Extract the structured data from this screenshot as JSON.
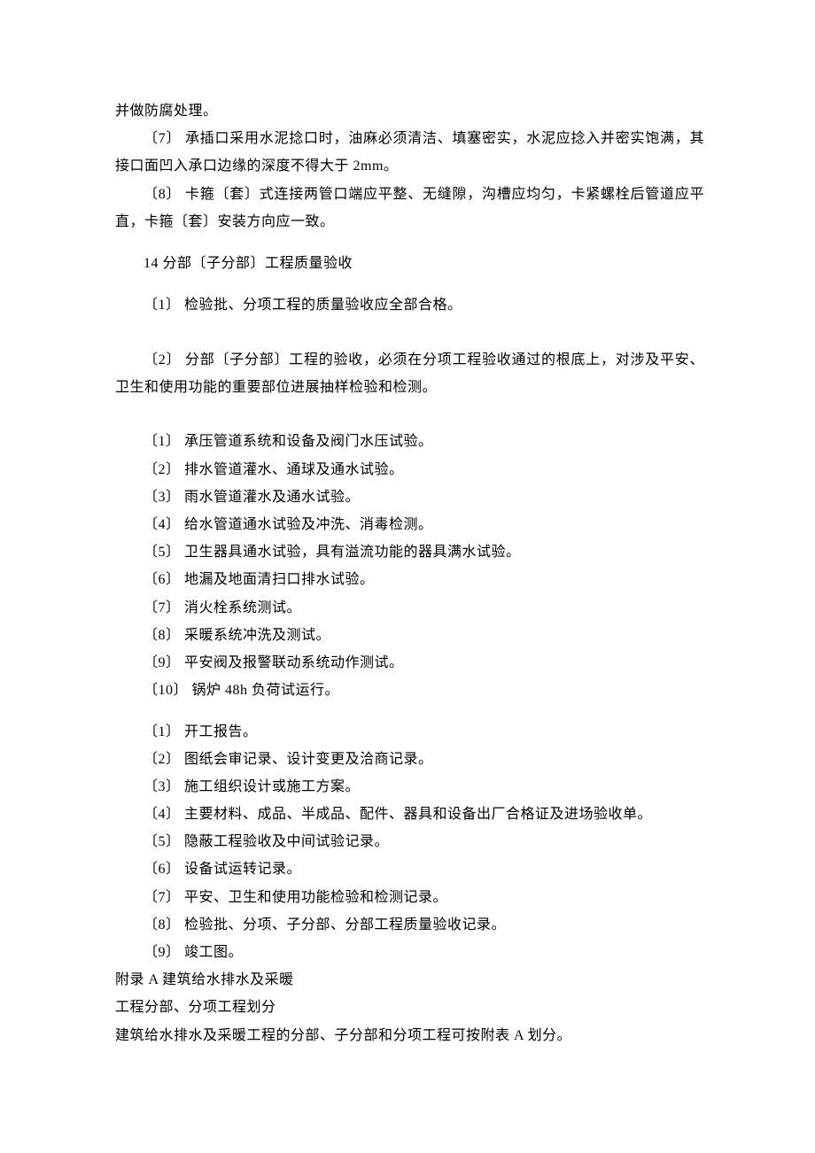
{
  "intro": {
    "line1": "并做防腐处理。",
    "line2": "〔7〕 承插口采用水泥捻口时，油麻必须清洁、填塞密实，水泥应捻入并密实饱满，其接口面凹入承口边缘的深度不得大于 2mm。",
    "line3": "〔8〕 卡箍〔套〕式连接两管口端应平整、无缝隙，沟槽应均匀，卡紧螺栓后管道应平直，卡箍〔套〕安装方向应一致。"
  },
  "section14": {
    "heading": "14 分部〔子分部〕工程质量验收",
    "item1": "〔1〕 检验批、分项工程的质量验收应全部合格。",
    "item2": "〔2〕 分部〔子分部〕工程的验收，必须在分项工程验收通过的根底上，对涉及平安、卫生和使用功能的重要部位进展抽样检验和检测。"
  },
  "listA": {
    "i1": "〔1〕 承压管道系统和设备及阀门水压试验。",
    "i2": "〔2〕 排水管道灌水、通球及通水试验。",
    "i3": "〔3〕 雨水管道灌水及通水试验。",
    "i4": "〔4〕 给水管道通水试验及冲洗、消毒检测。",
    "i5": "〔5〕 卫生器具通水试验，具有溢流功能的器具满水试验。",
    "i6": "〔6〕 地漏及地面清扫口排水试验。",
    "i7": "〔7〕 消火栓系统测试。",
    "i8": "〔8〕 采暖系统冲洗及测试。",
    "i9": "〔9〕 平安阀及报警联动系统动作测试。",
    "i10": "〔10〕 锅炉 48h 负荷试运行。"
  },
  "listB": {
    "i1": "〔1〕 开工报告。",
    "i2": "〔2〕 图纸会审记录、设计变更及洽商记录。",
    "i3": "〔3〕 施工组织设计或施工方案。",
    "i4": "〔4〕 主要材料、成品、半成品、配件、器具和设备出厂合格证及进场验收单。",
    "i5": "〔5〕 隐蔽工程验收及中间试验记录。",
    "i6": "〔6〕 设备试运转记录。",
    "i7": "〔7〕 平安、卫生和使用功能检验和检测记录。",
    "i8": "〔8〕 检验批、分项、子分部、分部工程质量验收记录。",
    "i9": "〔9〕 竣工图。"
  },
  "appendix": {
    "line1": "附录 A  建筑给水排水及采暖",
    "line2": "工程分部、分项工程划分",
    "line3": "建筑给水排水及采暖工程的分部、子分部和分项工程可按附表 A 划分。"
  }
}
